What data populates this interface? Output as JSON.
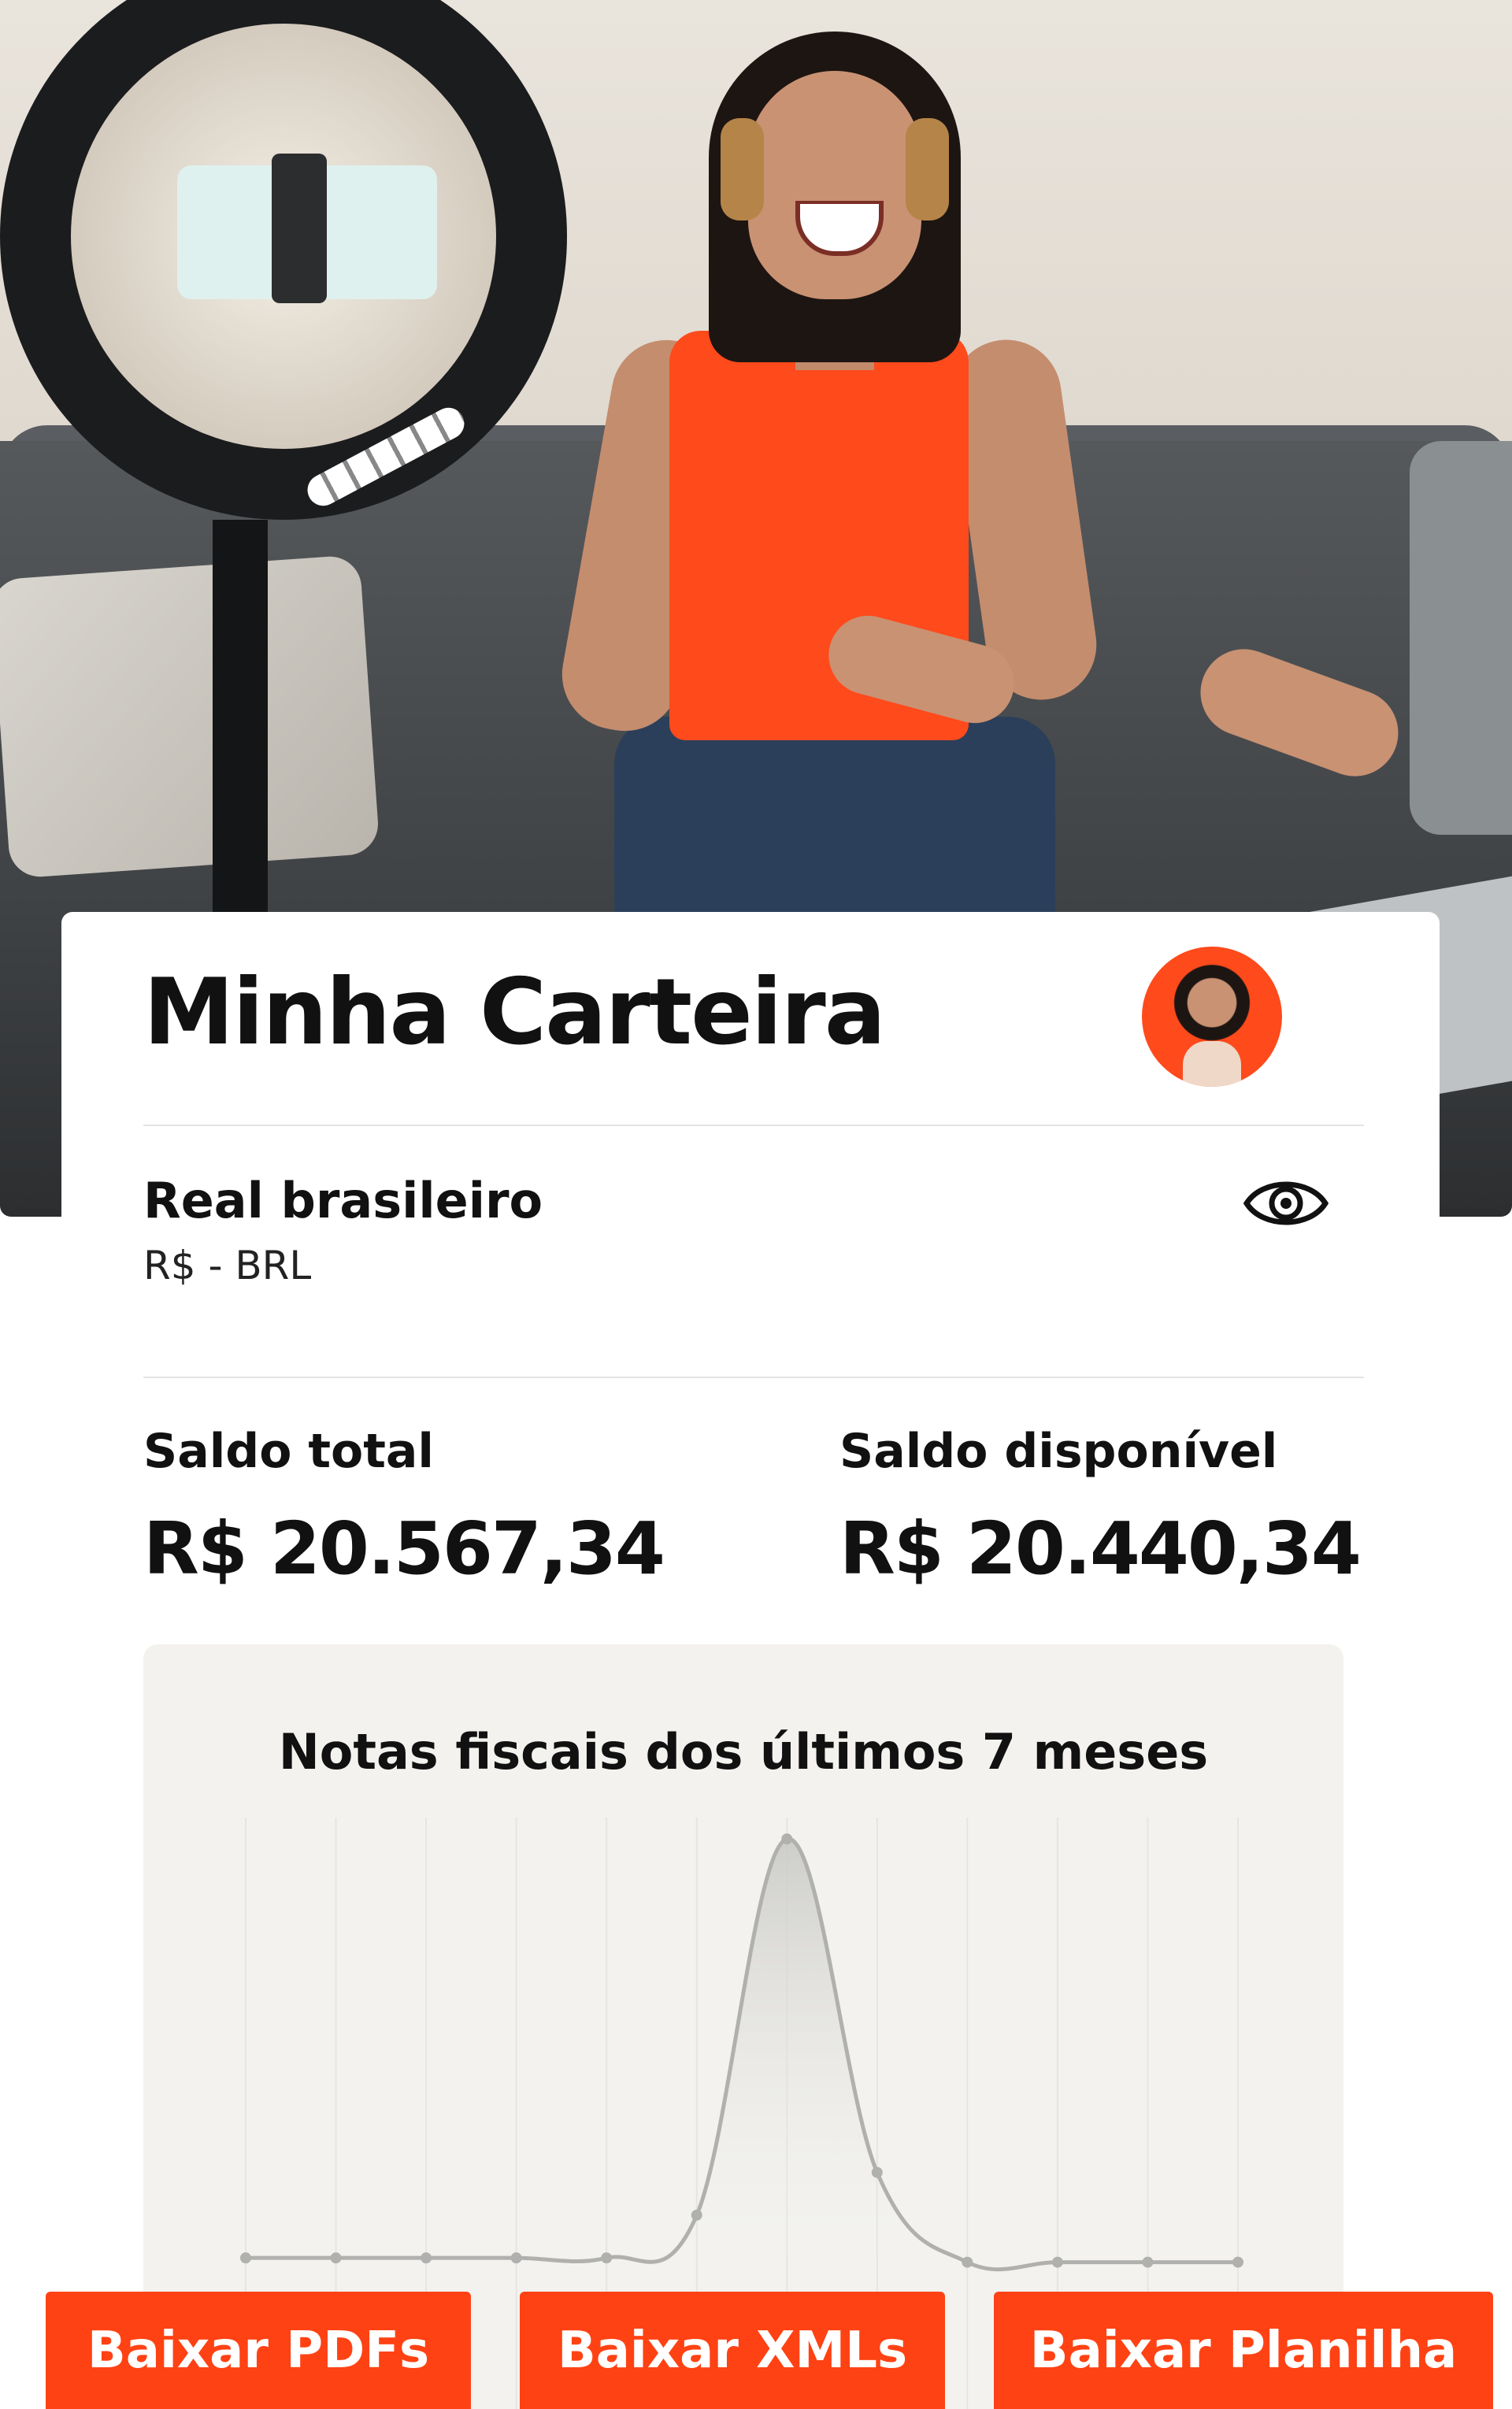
{
  "wallet": {
    "title": "Minha Carteira",
    "avatar_icon": "user-avatar"
  },
  "currency": {
    "name": "Real brasileiro",
    "code": "R$ - BRL",
    "visibility_icon": "eye-icon"
  },
  "balances": {
    "total_label": "Saldo total",
    "total_value": "R$ 20.567,34",
    "available_label": "Saldo disponível",
    "available_value": "R$ 20.440,34"
  },
  "chart": {
    "title": "Notas fiscais dos últimos 7 meses"
  },
  "chart_data": {
    "type": "area",
    "title": "Notas fiscais dos últimos 7 meses",
    "x": [
      1,
      2,
      3,
      4,
      5,
      6,
      7,
      8,
      9,
      10,
      11,
      12
    ],
    "values": [
      2,
      2,
      2,
      2,
      2,
      12,
      100,
      22,
      1,
      1,
      1,
      1
    ],
    "ylim": [
      0,
      105
    ],
    "grid": true,
    "legend": "none",
    "color": "#b0b0ae"
  },
  "actions": {
    "pdfs_label": "Baixar PDFs",
    "xmls_label": "Baixar XMLs",
    "sheet_label": "Baixar Planilha"
  },
  "colors": {
    "accent": "#ff4213",
    "chart_bg": "#f3f2ef",
    "text": "#111111"
  }
}
